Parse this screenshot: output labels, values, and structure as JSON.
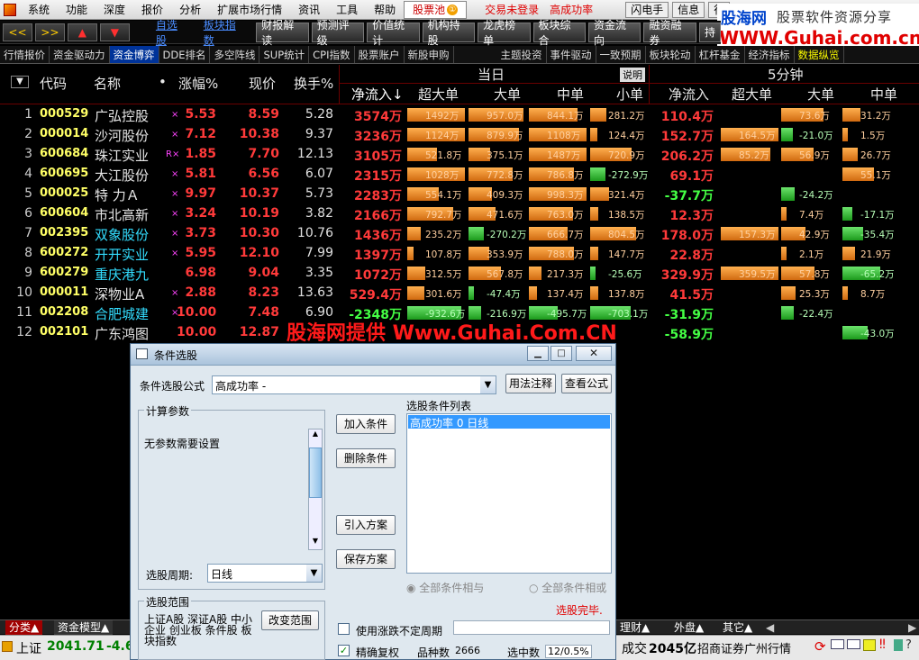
{
  "menu": {
    "items": [
      "系统",
      "功能",
      "深度",
      "报价",
      "分析",
      "扩展市场行情",
      "资讯",
      "工具",
      "帮助"
    ],
    "selected": "股票池",
    "selected_badge": "①",
    "status_text": "交易未登录",
    "formula_text": "高成功率",
    "right_buttons": [
      "闪电手",
      "信息",
      "行"
    ]
  },
  "brand": {
    "line1": "股海网",
    "line2": "股票软件资源分享",
    "line3": "WWW.Guhai.com.cn"
  },
  "toolbar": {
    "nav": [
      "<<",
      ">>",
      "▲",
      "▼"
    ],
    "links": [
      "自选股",
      "板块指数"
    ],
    "buttons": [
      "财报解读",
      "预测评级",
      "价值统计",
      "机构持股",
      "龙虎榜单",
      "板块综合",
      "资金流向",
      "融资融券",
      "持"
    ]
  },
  "subtabs": [
    "行情报价",
    "资金驱动力",
    "资金博弈",
    "DDE排名",
    "多空阵线",
    "SUP统计",
    "CPI指数",
    "股票账户",
    "新股申购",
    "主题投资",
    "事件驱动",
    "一致预期",
    "板块轮动",
    "杠杆基金",
    "经济指标",
    "数据纵览"
  ],
  "subtab_active": "资金博弈",
  "header": {
    "today": "当日",
    "explain": "说明",
    "five_min": "5分钟",
    "cols": [
      "代码",
      "名称",
      "涨幅%",
      "现价",
      "换手%",
      "净流入↓",
      "超大单",
      "大单",
      "中单",
      "小单",
      "净流入",
      "超大单",
      "大单",
      "中单"
    ]
  },
  "rows": [
    {
      "no": "1",
      "code": "000529",
      "name": "广弘控股",
      "mk": "×",
      "chg": "5.53",
      "price": "8.59",
      "turn": "5.28",
      "nf": "3574万",
      "b": [
        "1492万",
        "957.0万",
        "844.1万",
        "281.2万"
      ],
      "nf5": "110.4万",
      "b5": [
        "",
        "73.6万",
        "31.2万"
      ]
    },
    {
      "no": "2",
      "code": "000014",
      "name": "沙河股份",
      "mk": "×",
      "chg": "7.12",
      "price": "10.38",
      "turn": "9.37",
      "nf": "3236万",
      "b": [
        "1124万",
        "879.9万",
        "1108万",
        "124.4万"
      ],
      "nf5": "152.7万",
      "b5": [
        "164.5万",
        "-21.0万",
        "1.5万"
      ]
    },
    {
      "no": "3",
      "code": "600684",
      "name": "珠江实业",
      "mk": "R×",
      "chg": "1.85",
      "price": "7.70",
      "turn": "12.13",
      "nf": "3105万",
      "b": [
        "521.8万",
        "375.1万",
        "1487万",
        "720.9万"
      ],
      "nf5": "206.2万",
      "b5": [
        "85.2万",
        "56.9万",
        "26.7万"
      ]
    },
    {
      "no": "4",
      "code": "600695",
      "name": "大江股份",
      "mk": "×",
      "chg": "5.81",
      "price": "6.56",
      "turn": "6.07",
      "nf": "2315万",
      "b": [
        "1028万",
        "772.8万",
        "786.8万",
        "-272.9万"
      ],
      "nf5": "69.1万",
      "b5": [
        "",
        "",
        "55.1万"
      ]
    },
    {
      "no": "5",
      "code": "000025",
      "name": "特  力Ａ",
      "mk": "×",
      "chg": "9.97",
      "price": "10.37",
      "turn": "5.73",
      "nf": "2283万",
      "b": [
        "554.1万",
        "409.3万",
        "998.3万",
        "321.4万"
      ],
      "nf5": "-37.7万",
      "b5": [
        "",
        "-24.2万",
        ""
      ]
    },
    {
      "no": "6",
      "code": "600604",
      "name": "市北高新",
      "mk": "×",
      "chg": "3.24",
      "price": "10.19",
      "turn": "3.82",
      "nf": "2166万",
      "b": [
        "792.7万",
        "471.6万",
        "763.0万",
        "138.5万"
      ],
      "nf5": "12.3万",
      "b5": [
        "",
        "7.4万",
        "-17.1万"
      ]
    },
    {
      "no": "7",
      "code": "002395",
      "name": "双象股份",
      "mk": "×",
      "chg": "3.73",
      "price": "10.30",
      "turn": "10.76",
      "nf": "1436万",
      "b": [
        "235.2万",
        "-270.2万",
        "666.7万",
        "804.5万"
      ],
      "nf5": "178.0万",
      "b5": [
        "157.3万",
        "42.9万",
        "-35.4万"
      ]
    },
    {
      "no": "8",
      "code": "600272",
      "name": "开开实业",
      "mk": "×",
      "chg": "5.95",
      "price": "12.10",
      "turn": "7.99",
      "nf": "1397万",
      "b": [
        "107.8万",
        "353.9万",
        "788.0万",
        "147.7万"
      ],
      "nf5": "22.8万",
      "b5": [
        "",
        "2.1万",
        "21.9万"
      ]
    },
    {
      "no": "9",
      "code": "600279",
      "name": "重庆港九",
      "mk": "",
      "chg": "6.98",
      "price": "9.04",
      "turn": "3.35",
      "nf": "1072万",
      "b": [
        "312.5万",
        "567.8万",
        "217.3万",
        "-25.6万"
      ],
      "nf5": "329.9万",
      "b5": [
        "359.5万",
        "57.8万",
        "-65.2万"
      ]
    },
    {
      "no": "10",
      "code": "000011",
      "name": "深物业A",
      "mk": "×",
      "chg": "2.88",
      "price": "8.23",
      "turn": "13.63",
      "nf": "529.4万",
      "b": [
        "301.6万",
        "-47.4万",
        "137.4万",
        "137.8万"
      ],
      "nf5": "41.5万",
      "b5": [
        "",
        "25.3万",
        "8.7万"
      ]
    },
    {
      "no": "11",
      "code": "002208",
      "name": "合肥城建",
      "mk": "×",
      "chg": "10.00",
      "price": "7.48",
      "turn": "6.90",
      "nf": "-2348万",
      "b": [
        "-932.6万",
        "-216.9万",
        "-495.7万",
        "-703.1万"
      ],
      "nf5": "-31.9万",
      "b5": [
        "",
        "-22.4万",
        ""
      ]
    },
    {
      "no": "12",
      "code": "002101",
      "name": "广东鸿图",
      "mk": "",
      "chg": "10.00",
      "price": "12.87",
      "turn": "",
      "nf": "",
      "b": [
        "",
        "",
        "",
        ""
      ],
      "nf5": "-58.9万",
      "b5": [
        "",
        "",
        "-43.0万"
      ]
    }
  ],
  "watermark": "股海网提供 Www.Guhai.Com.CN",
  "dialog": {
    "title": "条件选股",
    "formula_label": "条件选股公式",
    "formula_value": "高成功率 -",
    "btn_usage": "用法注释",
    "btn_view": "查看公式",
    "calc_params": "计算参数",
    "no_params": "无参数需要设置",
    "btn_add": "加入条件",
    "btn_delete": "删除条件",
    "btn_import": "引入方案",
    "btn_save": "保存方案",
    "list_title": "选股条件列表",
    "list_item": "高成功率  0  日线",
    "period_label": "选股周期:",
    "period_value": "日线",
    "radio_and": "全部条件相与",
    "radio_or": "全部条件相或",
    "done_text": "选股完毕.",
    "range_label": "选股范围",
    "range_text": "上证A股 深证A股 中小企业 创业板 条件股 板块指数",
    "btn_change_range": "改变范围",
    "chk_uncertain": "使用涨跌不定周期",
    "chk_precise": "精确复权",
    "count_label": "品种数",
    "count_value": "2666",
    "selected_label": "选中数",
    "selected_value": "12/0.5%"
  },
  "bottom_tabs": [
    "分类▲",
    "资金模型▲",
    "理财▲",
    "外盘▲",
    "其它▲"
  ],
  "status": {
    "index_name": "上证",
    "index_value": "2041.71",
    "index_change": "-4.6",
    "volume_label": "成交",
    "volume_value": "2045亿",
    "broker": "招商证券广州行情"
  }
}
